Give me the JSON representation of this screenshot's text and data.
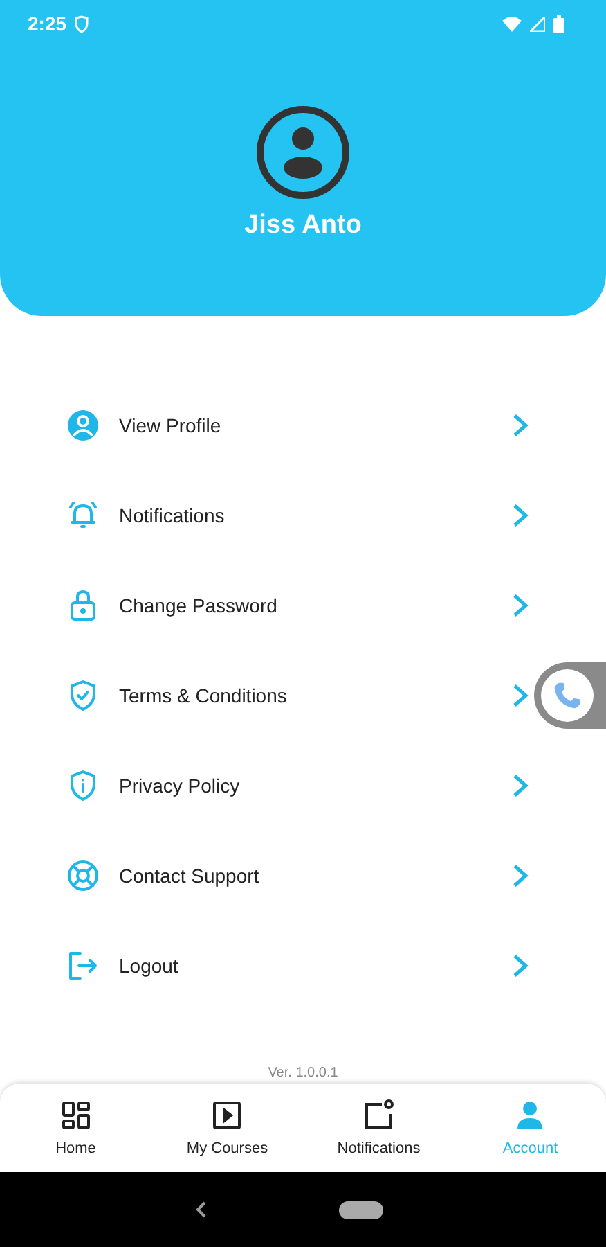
{
  "status_bar": {
    "time": "2:25"
  },
  "profile": {
    "name": "Jiss Anto"
  },
  "menu": [
    {
      "kind": "profile",
      "label": "View Profile"
    },
    {
      "kind": "bell",
      "label": "Notifications"
    },
    {
      "kind": "lock",
      "label": "Change Password"
    },
    {
      "kind": "shield-check",
      "label": "Terms & Conditions"
    },
    {
      "kind": "shield-info",
      "label": "Privacy Policy"
    },
    {
      "kind": "support",
      "label": "Contact Support"
    },
    {
      "kind": "logout",
      "label": "Logout"
    }
  ],
  "version": "Ver. 1.0.0.1",
  "bottom_nav": [
    {
      "kind": "home",
      "label": "Home",
      "selected": false
    },
    {
      "kind": "courses",
      "label": "My Courses",
      "selected": false
    },
    {
      "kind": "notifications",
      "label": "Notifications",
      "selected": false
    },
    {
      "kind": "account",
      "label": "Account",
      "selected": true
    }
  ]
}
